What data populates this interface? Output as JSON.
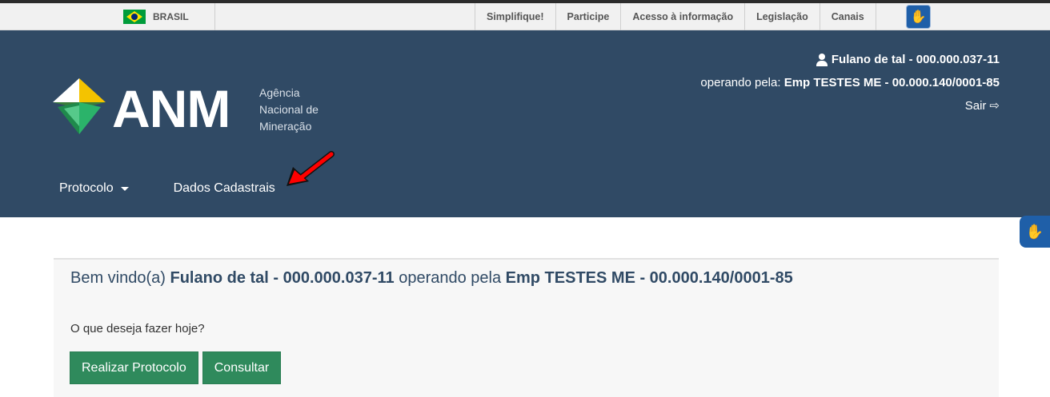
{
  "govbar": {
    "brasil_label": "BRASIL",
    "links": [
      "Simplifique!",
      "Participe",
      "Acesso à informação",
      "Legislação",
      "Canais"
    ],
    "vlibras_icon": "vlibras-hands-icon"
  },
  "header": {
    "user_name": "Fulano de tal - 000.000.037-11",
    "operating_prefix": "operando pela:",
    "company": "Emp TESTES ME - 00.000.140/0001-85",
    "logout_label": "Sair",
    "logout_icon": "sign-out-icon",
    "user_icon": "user-icon"
  },
  "logo": {
    "name": "ANM",
    "subtitle_lines": [
      "Agência",
      "Nacional de",
      "Mineração"
    ]
  },
  "nav": {
    "items": [
      {
        "label": "Protocolo",
        "has_dropdown": true
      },
      {
        "label": "Dados Cadastrais",
        "has_dropdown": false
      }
    ]
  },
  "annotation": {
    "arrow_color": "#ff0000",
    "arrow_icon": "red-arrow-icon"
  },
  "main": {
    "welcome_prefix": "Bem vindo(a)",
    "welcome_user": "Fulano de tal - 000.000.037-11",
    "welcome_mid": "operando pela",
    "welcome_company": "Emp TESTES ME - 00.000.140/0001-85",
    "question": "O que deseja fazer hoje?",
    "buttons": [
      "Realizar Protocolo",
      "Consultar"
    ]
  },
  "colors": {
    "header_bg": "#304a65",
    "button_bg": "#2f8a5c",
    "vlibras_blue": "#1f5fa8"
  }
}
